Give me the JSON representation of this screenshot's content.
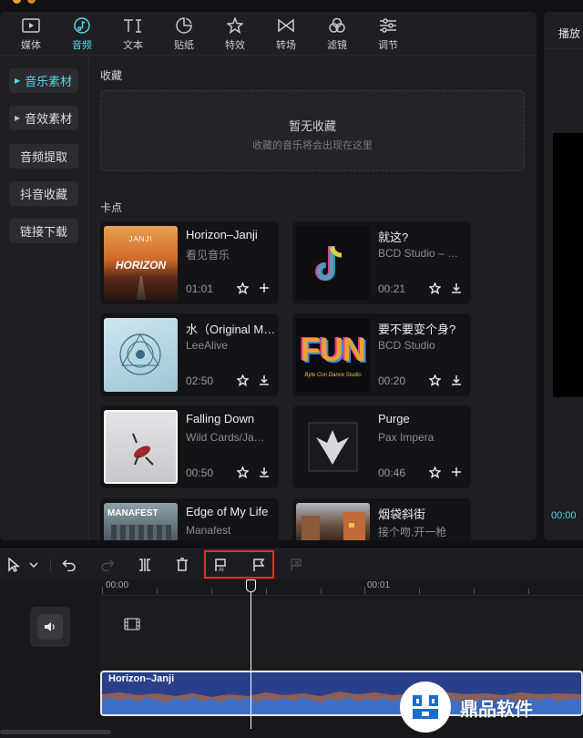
{
  "nav": {
    "items": [
      {
        "label": "媒体",
        "icon": "media-icon"
      },
      {
        "label": "音频",
        "icon": "audio-icon"
      },
      {
        "label": "文本",
        "icon": "text-icon"
      },
      {
        "label": "贴纸",
        "icon": "sticker-icon"
      },
      {
        "label": "特效",
        "icon": "effects-icon"
      },
      {
        "label": "转场",
        "icon": "transition-icon"
      },
      {
        "label": "滤镜",
        "icon": "filter-icon"
      },
      {
        "label": "调节",
        "icon": "adjust-icon"
      }
    ],
    "active": "音频"
  },
  "sidebar": {
    "items": [
      {
        "label": "音乐素材"
      },
      {
        "label": "音效素材"
      },
      {
        "label": "音频提取"
      },
      {
        "label": "抖音收藏"
      },
      {
        "label": "链接下载"
      }
    ]
  },
  "favorites": {
    "title": "收藏",
    "empty_title": "暂无收藏",
    "empty_hint": "收藏的音乐将会出现在这里"
  },
  "beats": {
    "title": "卡点",
    "cards": [
      {
        "title": "Horizon–Janji",
        "artist": "看见音乐",
        "duration": "01:01",
        "action": "add-icon"
      },
      {
        "title": "就这?",
        "artist": "BCD Studio – …",
        "duration": "00:21",
        "action": "download-icon"
      },
      {
        "title": "水（Original M…",
        "artist": "LeeAlive",
        "duration": "02:50",
        "action": "download-icon"
      },
      {
        "title": "要不要变个身?",
        "artist": "BCD Studio",
        "duration": "00:20",
        "action": "download-icon"
      },
      {
        "title": "Falling Down",
        "artist": "Wild Cards/Ja…",
        "duration": "00:50",
        "action": "download-icon"
      },
      {
        "title": "Purge",
        "artist": "Pax Impera",
        "duration": "00:46",
        "action": "add-icon"
      },
      {
        "title": "Edge of My Life",
        "artist": "Manafest",
        "duration": "",
        "action": ""
      },
      {
        "title": "烟袋斜街",
        "artist": "接个吻,开一枪",
        "duration": "",
        "action": ""
      }
    ],
    "cover_text": {
      "c1_top": "JANJI",
      "c1_main": "HORIZON",
      "c4_main": "FUN",
      "c4_sub": "Byte Con Dance Studio",
      "c7_main": "MANAFEST"
    }
  },
  "preview": {
    "title": "播放",
    "time": "00:00"
  },
  "timeline": {
    "ruler_labels": [
      "00:00",
      "00:01"
    ],
    "clip_label": "Horizon–Janji"
  },
  "watermark": {
    "text": "鼎品软件"
  },
  "colors": {
    "accent": "#56d6e6",
    "highlight_box": "#e0302a",
    "audio_clip": "#2a3f8a",
    "waveform": "#e07a2e"
  }
}
